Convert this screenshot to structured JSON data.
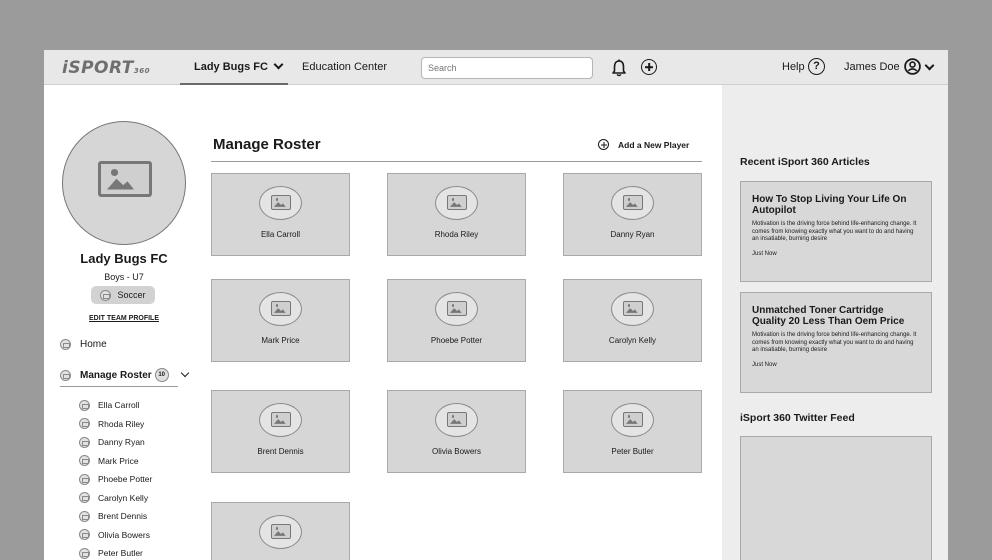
{
  "header": {
    "logo_text": "iSPORT",
    "logo_suffix": "360",
    "team_selector": "Lady Bugs FC",
    "education_link": "Education Center",
    "search_placeholder": "Search",
    "help_label": "Help",
    "help_icon_glyph": "?",
    "user_name": "James Doe"
  },
  "team": {
    "name": "Lady Bugs FC",
    "division": "Boys - U7",
    "sport": "Soccer",
    "edit_profile": "EDIT TEAM PROFILE"
  },
  "nav": {
    "home": "Home",
    "manage_roster": "Manage Roster",
    "roster_count": "10",
    "players": [
      "Ella Carroll",
      "Rhoda Riley",
      "Danny Ryan",
      "Mark Price",
      "Phoebe Potter",
      "Carolyn Kelly",
      "Brent Dennis",
      "Olivia Bowers",
      "Peter Butler"
    ]
  },
  "roster": {
    "title": "Manage Roster",
    "add_player": "Add a New Player",
    "cards": [
      "Ella Carroll",
      "Rhoda Riley",
      "Danny Ryan",
      "Mark Price",
      "Phoebe Potter",
      "Carolyn Kelly",
      "Brent Dennis",
      "Olivia Bowers",
      "Peter Butler",
      ""
    ]
  },
  "sidebar": {
    "articles_heading": "Recent iSport 360 Articles",
    "articles": [
      {
        "title": "How To Stop Living Your Life On Autopilot",
        "body": "Motivation is the driving force behind life-enhancing change. It comes from knowing exactly what you want to do and having an insatiable, burning desire",
        "time": "Just Now"
      },
      {
        "title": "Unmatched Toner Cartridge Quality 20 Less Than Oem Price",
        "body": "Motivation is the driving force behind life-enhancing change. It comes from knowing exactly what you want to do and having an insatiable, burning desire",
        "time": "Just Now"
      }
    ],
    "twitter_heading": "iSport 360 Twitter Feed"
  },
  "colors": {
    "page_background": "#9b9b9b",
    "topbar": "#e8e8e8",
    "placeholder_fill": "#d6d6d6",
    "right_rail": "#ededed"
  }
}
